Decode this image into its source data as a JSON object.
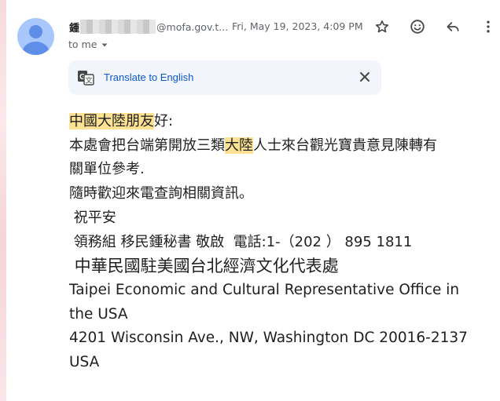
{
  "sender": {
    "name_visible": "鍾",
    "email_visible": "@mofa.gov.t...",
    "timestamp": "Fri, May 19, 2023, 4:09 PM"
  },
  "recipient": {
    "label": "to me"
  },
  "actions": {
    "icons": [
      "star-icon",
      "emoji-icon",
      "reply-icon",
      "more-vert-icon"
    ]
  },
  "translate": {
    "label": "Translate to English"
  },
  "body": {
    "greeting_hl": "中國大陸朋友",
    "greeting_rest": "好:",
    "line2_a": "本處會把台端第開放三類",
    "line2_hl": "大陸",
    "line2_b": "人士來台觀光寶貴意見陳轉有",
    "line3": "關單位參考.",
    "line4": "隨時歡迎來電查詢相關資訊。",
    "line5": " 祝平安",
    "line6": " 領務組 移民鍾秘書 敬啟  電話:1-（202 ） 895 1811",
    "office_cn": " 中華民國駐美國台北經濟文化代表處",
    "office_en": "Taipei Economic and Cultural Representative Office in the USA",
    "address": " 4201 Wisconsin Ave., NW, Washington DC  20016-2137 USA"
  },
  "colors": {
    "highlight": "#fde293",
    "link_blue": "#0b57d0",
    "translate_bg": "#f2f6fc",
    "avatar_bg": "#a8c7fa",
    "avatar_fg": "#5e8ee8"
  }
}
